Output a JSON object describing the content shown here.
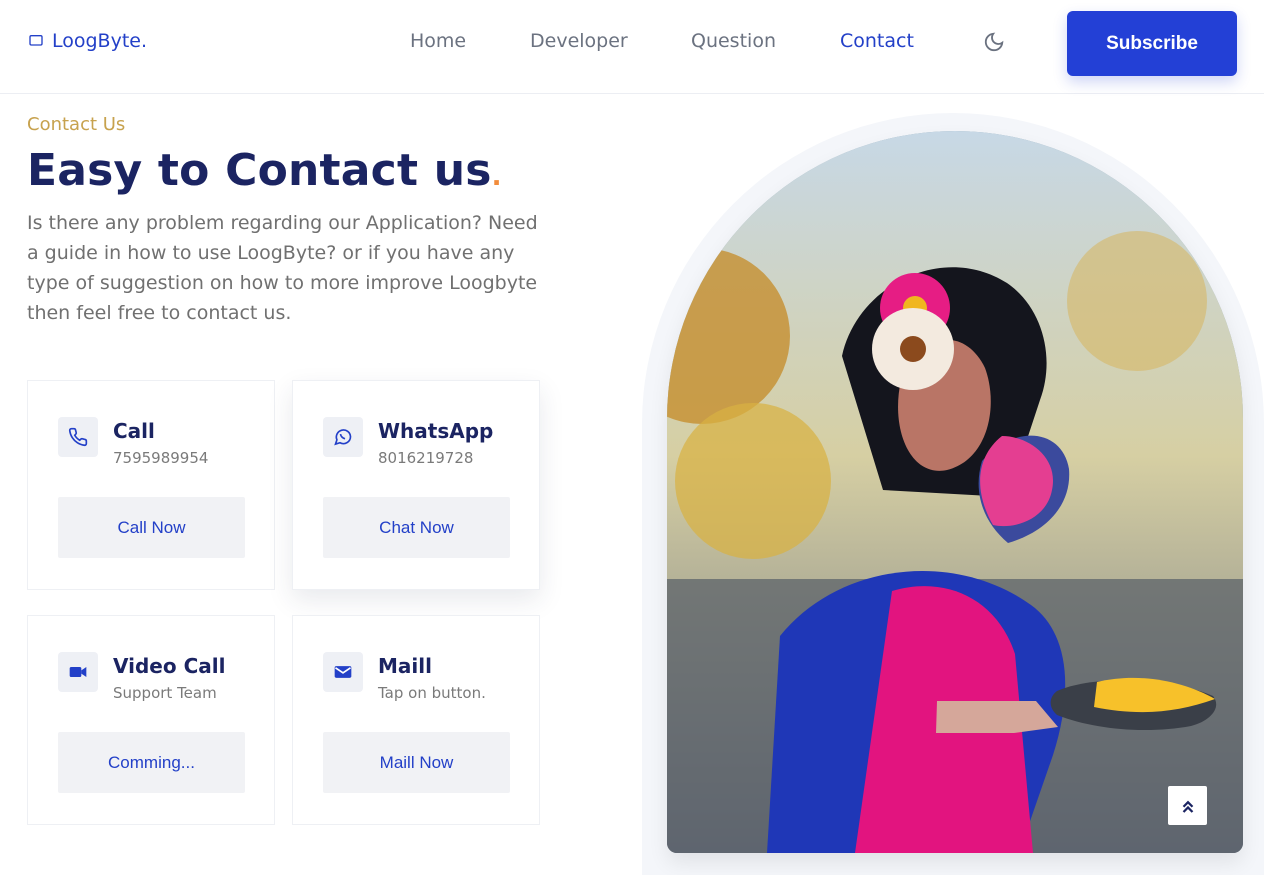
{
  "brand": {
    "name": "LoogByte."
  },
  "nav": {
    "items": [
      {
        "label": "Home"
      },
      {
        "label": "Developer"
      },
      {
        "label": "Question"
      },
      {
        "label": "Contact"
      }
    ],
    "active_item": "Contact",
    "theme_icon": "moon-icon",
    "subscribe_label": "Subscribe"
  },
  "hero": {
    "eyebrow": "Contact Us",
    "title": "Easy to Contact us",
    "title_dot": ".",
    "description": "Is there any problem regarding our Application? Need a guide in how to use LoogByte? or if you have any type of suggestion on how to more improve Loogbyte then feel free to contact us."
  },
  "cards": [
    {
      "icon": "phone-icon",
      "title": "Call",
      "subtitle": "7595989954",
      "button": "Call Now"
    },
    {
      "icon": "whatsapp-icon",
      "title": "WhatsApp",
      "subtitle": "8016219728",
      "button": "Chat Now"
    },
    {
      "icon": "video-camera-icon",
      "title": "Video Call",
      "subtitle": "Support Team",
      "button": "Comming..."
    },
    {
      "icon": "mail-icon",
      "title": "Maill",
      "subtitle": "Tap on button.",
      "button": "Maill Now"
    }
  ],
  "photo": {
    "subject": "woman in pink sari with colored powder on hand"
  },
  "scroll_top_icon": "double-chevron-up-icon",
  "colors": {
    "accent": "#2340d6",
    "heading": "#1b2462",
    "eyebrow": "#c7a24e",
    "text": "#707070"
  }
}
